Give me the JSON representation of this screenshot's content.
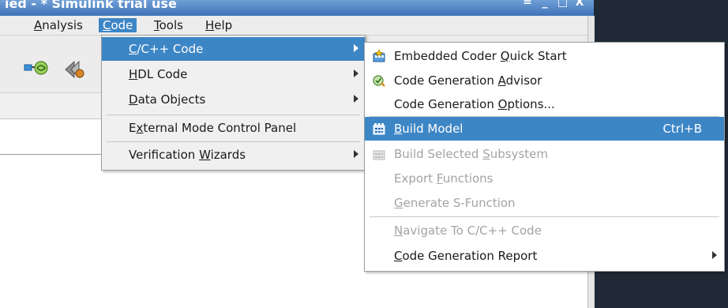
{
  "window": {
    "title": "ied - * Simulink trial use",
    "controls": [
      "≚",
      "_",
      "□",
      "X"
    ]
  },
  "menubar": {
    "analysis": {
      "pre": "",
      "mn": "A",
      "post": "nalysis"
    },
    "code": {
      "pre": "",
      "mn": "C",
      "post": "ode"
    },
    "tools": {
      "pre": "",
      "mn": "T",
      "post": "ools"
    },
    "help": {
      "pre": "",
      "mn": "H",
      "post": "elp"
    }
  },
  "code_menu": [
    {
      "pre": "",
      "mn": "C",
      "post": "/C++ Code",
      "submenu": true,
      "highlight": true
    },
    {
      "pre": "",
      "mn": "H",
      "post": "DL Code",
      "submenu": true
    },
    {
      "pre": "",
      "mn": "D",
      "post": "ata Objects",
      "submenu": true
    },
    {
      "pre": "E",
      "mn": "x",
      "post": "ternal Mode Control Panel",
      "submenu": false
    },
    {
      "pre": "Verification ",
      "mn": "W",
      "post": "izards",
      "submenu": true
    }
  ],
  "submenu": {
    "embedded_coder_quick_start": {
      "pre": "Embedded Coder ",
      "mn": "Q",
      "post": "uick Start",
      "icon": "quick-start-icon"
    },
    "code_generation_advisor": {
      "pre": "Code Generation ",
      "mn": "A",
      "post": "dvisor",
      "icon": "advisor-icon"
    },
    "code_generation_options": {
      "pre": "Code Generation ",
      "mn": "O",
      "post": "ptions..."
    },
    "build_model": {
      "pre": "",
      "mn": "B",
      "post": "uild Model",
      "shortcut": "Ctrl+B",
      "icon": "build-icon"
    },
    "build_selected_subsystem": {
      "pre": "Build Selected ",
      "mn": "S",
      "post": "ubsystem",
      "icon": "build-subsystem-icon"
    },
    "export_functions": {
      "pre": "Export ",
      "mn": "F",
      "post": "unctions"
    },
    "generate_s_function": {
      "pre": "",
      "mn": "G",
      "post": "enerate S-Function"
    },
    "navigate_to_code": {
      "pre": "",
      "mn": "N",
      "post": "avigate To C/C++ Code"
    },
    "code_generation_report": {
      "pre": "",
      "mn": "C",
      "post": "ode Generation Report"
    }
  },
  "colors": {
    "highlight": "#3d86c6",
    "disabled_text": "#a3a3a3",
    "desktop": "#1f2a36",
    "titlebar": "#4f83c4"
  }
}
